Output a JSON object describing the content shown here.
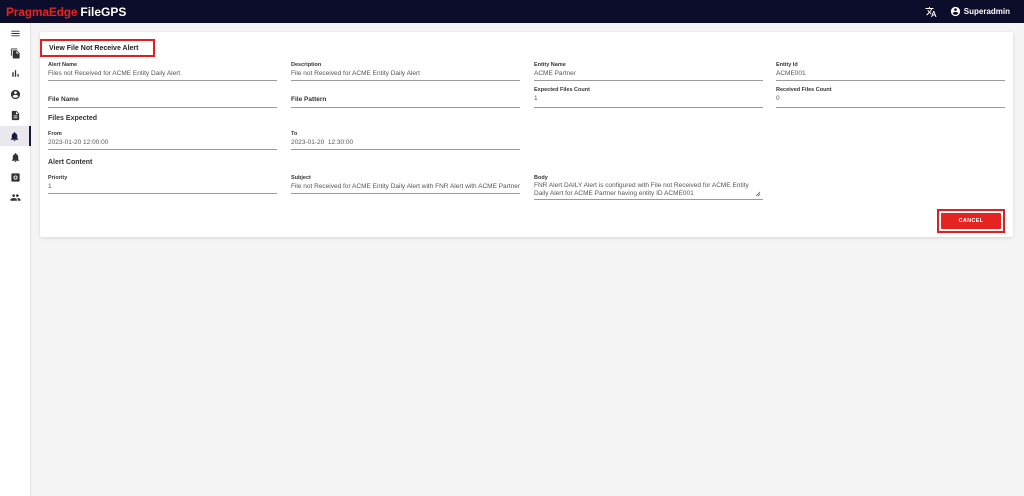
{
  "app": {
    "brand_part1": "PragmaEdge",
    "brand_part2": "FileGPS",
    "user_name": "Superadmin"
  },
  "page": {
    "title": "View File Not Receive Alert"
  },
  "fields": {
    "alert_name": {
      "label": "Alert Name",
      "value": "Files not Received for ACME Entity Daily Alert"
    },
    "description": {
      "label": "Description",
      "value": "File not Received for ACME Entity Daily Alert"
    },
    "entity_name": {
      "label": "Entity Name",
      "value": "ACME Partner"
    },
    "entity_id": {
      "label": "Entity Id",
      "value": "ACME001"
    },
    "file_name": {
      "label": "File Name",
      "value": ""
    },
    "file_pattern": {
      "label": "File Pattern",
      "value": ""
    },
    "expected_files_count": {
      "label": "Expected Files Count",
      "value": "1"
    },
    "received_files_count": {
      "label": "Received Files Count",
      "value": "0"
    },
    "from": {
      "label": "From",
      "value": "2023-01-20 12:00:00"
    },
    "to": {
      "label": "To",
      "value": "2023-01-20  12:30:00"
    },
    "priority": {
      "label": "Priority",
      "value": "1"
    },
    "subject": {
      "label": "Subject",
      "value": "File not Received for ACME Entity Daily Alert with FNR Alert with ACME Partner"
    },
    "body": {
      "label": "Body",
      "value": "FNR Alert DAILY Alert is configured with File not Received for ACME Entity Daily Alert for ACME Partner having entity ID ACME001"
    }
  },
  "sections": {
    "files_expected": "Files Expected",
    "alert_content": "Alert Content"
  },
  "actions": {
    "cancel_label": "CANCEL"
  },
  "icons": {
    "sidebar": [
      "menu-icon",
      "files-icon",
      "bar-chart-icon",
      "account-circle-icon",
      "document-icon",
      "bell-icon",
      "bell-alert-icon",
      "settings-box-icon",
      "people-icon"
    ],
    "topbar": [
      "translate-icon",
      "account-circle-icon"
    ]
  },
  "colors": {
    "topbar_bg": "#0c0c2b",
    "brand_red": "#e52421",
    "highlight_red": "#e02020",
    "cancel_bg": "#e52421"
  }
}
